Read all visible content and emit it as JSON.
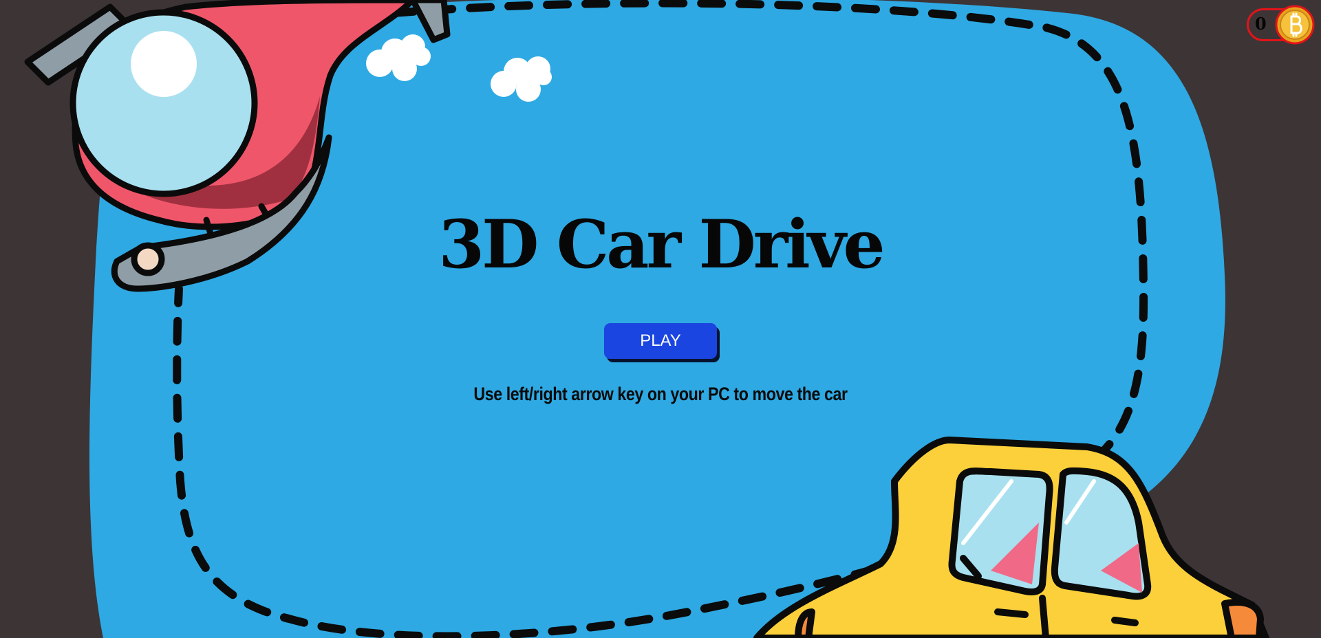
{
  "game": {
    "title": "3D Car Drive",
    "play_label": "PLAY",
    "instructions": "Use left/right arrow key on your PC to move the car"
  },
  "hud": {
    "coin_count": "0",
    "coin_icon": "bitcoin-coin-icon"
  },
  "colors": {
    "background": "#3d3436",
    "blob": "#2ea9e3",
    "play_button": "#1a45e0",
    "helicopter": "#f0566a",
    "car": "#fcd03a",
    "coin_border": "#e2141a"
  }
}
